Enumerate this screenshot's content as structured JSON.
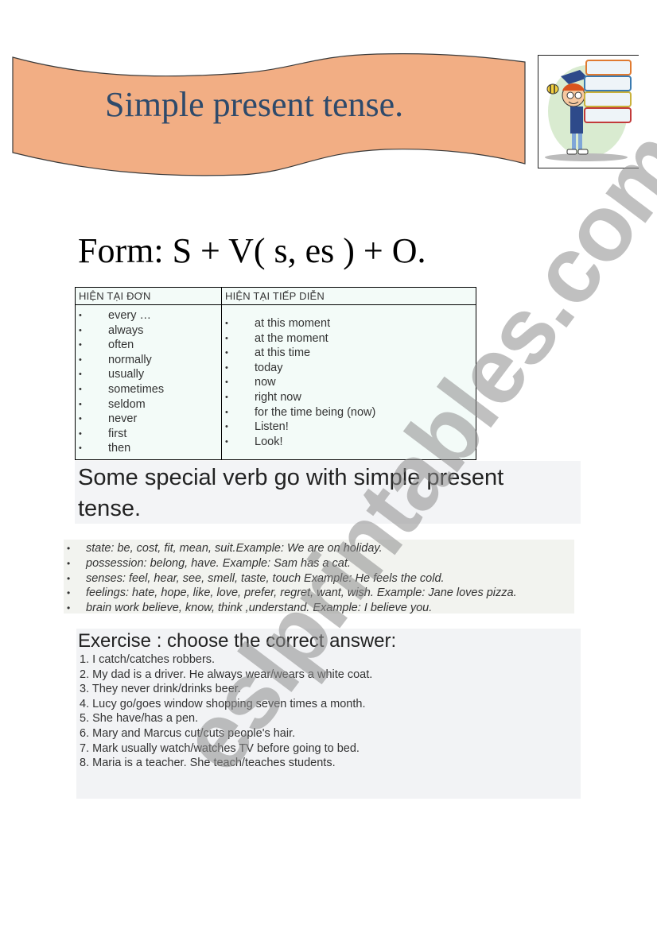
{
  "banner": {
    "title": "Simple present tense.",
    "fill_color": "#f2ae84",
    "title_color": "#2e4a6b"
  },
  "illustration": {
    "description": "cartoon student carrying stack of books"
  },
  "form": {
    "text": "Form: S + V( s, es ) + O."
  },
  "tense_table": {
    "background_color": "#f3fbf8",
    "columns": [
      {
        "header": "HIỆN TẠI ĐƠN",
        "items": [
          "every …",
          "always",
          "often",
          "normally",
          "usually",
          "sometimes",
          "seldom",
          "never",
          "first",
          "then"
        ]
      },
      {
        "header": "HIỆN TẠI TIẾP DIỄN",
        "items": [
          "at this moment",
          "at the moment",
          "at this time",
          "today",
          "now",
          "right now",
          "for the time being (now)",
          "Listen!",
          "Look!"
        ]
      }
    ],
    "bullet": "•"
  },
  "special_verbs": {
    "title": "Some special verb go with simple present tense.",
    "items": [
      "state: be, cost, fit, mean, suit.Example: We are on holiday.",
      "possession:  belong, have.   Example: Sam has a cat.",
      "senses: feel, hear, see, smell, taste, touch Example:  He feels the cold.",
      "feelings:  hate, hope, like, love, prefer, regret, want, wish. Example: Jane loves pizza.",
      "brain work  believe, know, think ,understand.  Example: I believe you."
    ]
  },
  "exercise": {
    "title": "Exercise : choose the correct answer:",
    "items": [
      "1. I catch/catches robbers.",
      "2. My dad is a driver. He always wear/wears a white coat.",
      "3. They never drink/drinks beer.",
      "4. Lucy go/goes window shopping seven times a month.",
      "5. She have/has a pen.",
      "6. Mary and Marcus cut/cuts people's hair.",
      "7. Mark usually watch/watches TV before going to bed.",
      "8. Maria is a teacher. She teach/teaches students."
    ]
  },
  "watermark": {
    "text": "eslprintables.com"
  }
}
